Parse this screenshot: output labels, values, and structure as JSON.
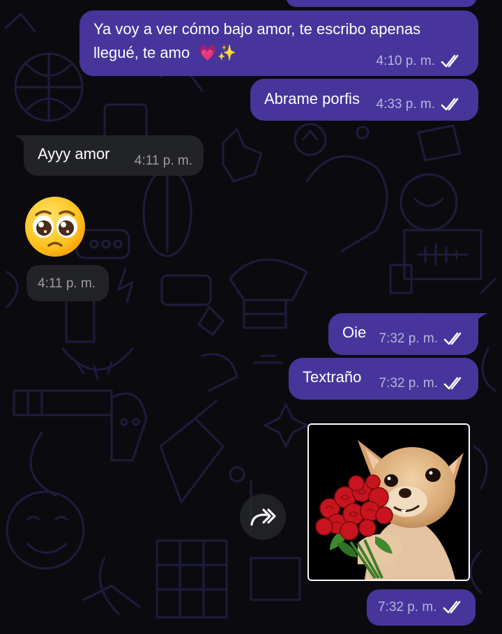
{
  "colors": {
    "outgoing_bubble": "#47359c",
    "incoming_bubble": "#222326",
    "background": "#0b0b0f",
    "doodle": "#1d1c3a"
  },
  "messages": [
    {
      "id": "m1",
      "direction": "outgoing",
      "line1": "Ya voy a ver cómo bajo amor, te escribo apenas",
      "line2": "llegué, te amo",
      "emoji": "💗✨",
      "time": "4:10 p. m.",
      "status": "read"
    },
    {
      "id": "m2",
      "direction": "outgoing",
      "text": "Abrame porfis",
      "time": "4:33 p. m.",
      "status": "read"
    },
    {
      "id": "m3",
      "direction": "incoming",
      "text": "Ayyy amor",
      "time": "4:11 p. m."
    },
    {
      "id": "m4",
      "direction": "incoming",
      "emoji": "🥺",
      "time": "4:11 p. m."
    },
    {
      "id": "m5",
      "direction": "outgoing",
      "text": "Oie",
      "time": "7:32 p. m.",
      "status": "read"
    },
    {
      "id": "m6",
      "direction": "outgoing",
      "text": "Textraño",
      "time": "7:32 p. m.",
      "status": "read"
    },
    {
      "id": "m7",
      "direction": "outgoing",
      "type": "sticker",
      "sticker_icon": "chihuahua-with-roses-sticker",
      "time": "7:32 p. m.",
      "status": "read"
    }
  ],
  "icons": {
    "read_ticks": "double-check-icon",
    "forward": "forward-arrow-icon"
  }
}
